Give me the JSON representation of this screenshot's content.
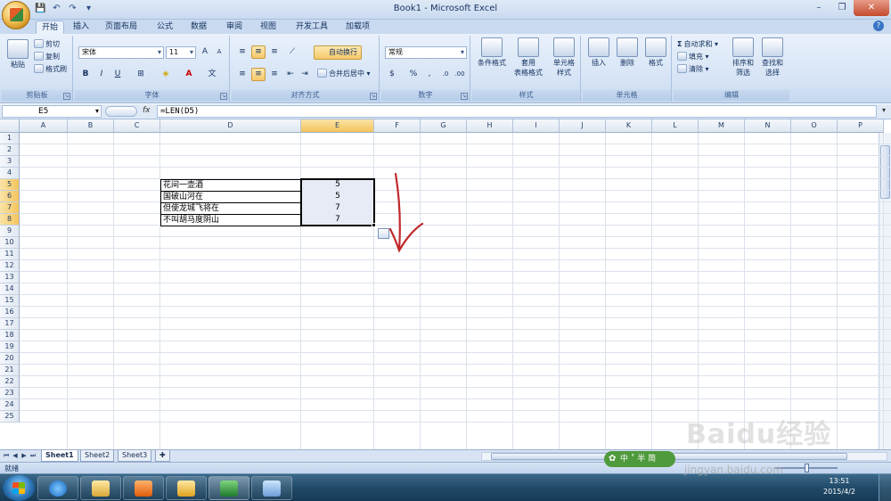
{
  "window": {
    "title": "Book1 - Microsoft Excel",
    "controls": [
      "–",
      "❐",
      "✕"
    ]
  },
  "qat": [
    "💾",
    "↶",
    "↷",
    "▾"
  ],
  "tabs": [
    "开始",
    "插入",
    "页面布局",
    "公式",
    "数据",
    "审阅",
    "视图",
    "开发工具",
    "加载项"
  ],
  "ribbon": {
    "clipboard": {
      "label": "剪贴板",
      "paste": "粘贴",
      "cut": "剪切",
      "copy": "复制",
      "format_painter": "格式刷"
    },
    "font": {
      "label": "字体",
      "name": "宋体",
      "size": "11",
      "bold": "B",
      "italic": "I",
      "underline": "U"
    },
    "alignment": {
      "label": "对齐方式",
      "wrap": "自动换行",
      "merge": "合并后居中"
    },
    "number": {
      "label": "数字",
      "format": "常规",
      "percent": "%",
      "comma": ","
    },
    "styles": {
      "label": "样式",
      "conditional": "条件格式",
      "table": "套用\n表格格式",
      "cell_styles": "单元格\n样式"
    },
    "cells": {
      "label": "单元格",
      "insert": "插入",
      "delete": "删除",
      "format": "格式"
    },
    "editing": {
      "label": "编辑",
      "autosum": "自动求和",
      "fill": "填充",
      "clear": "清除",
      "sort": "排序和\n筛选",
      "find": "查找和\n选择"
    }
  },
  "formula_bar": {
    "name_box": "E5",
    "fx": "fx",
    "formula": "=LEN(D5)"
  },
  "columns": [
    "A",
    "B",
    "C",
    "D",
    "E",
    "F",
    "G",
    "H",
    "I",
    "J",
    "K",
    "L",
    "M",
    "N",
    "O",
    "P"
  ],
  "rows": [
    "1",
    "2",
    "3",
    "4",
    "5",
    "6",
    "7",
    "8",
    "9",
    "10",
    "11",
    "12",
    "13",
    "14",
    "15",
    "16",
    "17",
    "18",
    "19",
    "20",
    "21",
    "22",
    "23",
    "24",
    "25"
  ],
  "cells": {
    "D5": "花间一壶酒",
    "D6": "国破山河在",
    "D7": "但使龙城飞将在",
    "D8": "不叫胡马度阴山",
    "E5": "5",
    "E6": "5",
    "E7": "7",
    "E8": "7"
  },
  "selection": {
    "active_column": "E",
    "active_rows": [
      "5",
      "6",
      "7",
      "8"
    ]
  },
  "sheets": [
    "Sheet1",
    "Sheet2",
    "Sheet3"
  ],
  "status": {
    "ready": "就绪"
  },
  "taskbar": {
    "time": "13:51",
    "date": "2015/4/2"
  },
  "overlays": {
    "ime": "中 ˚ 半 简",
    "watermark": "Baidu经验",
    "watermark_url": "jingyan.baidu.com"
  },
  "colors": {
    "arrow": "#c0282a",
    "selection_fill": "#e7ebf5",
    "header_highlight": "#f3c55b"
  }
}
